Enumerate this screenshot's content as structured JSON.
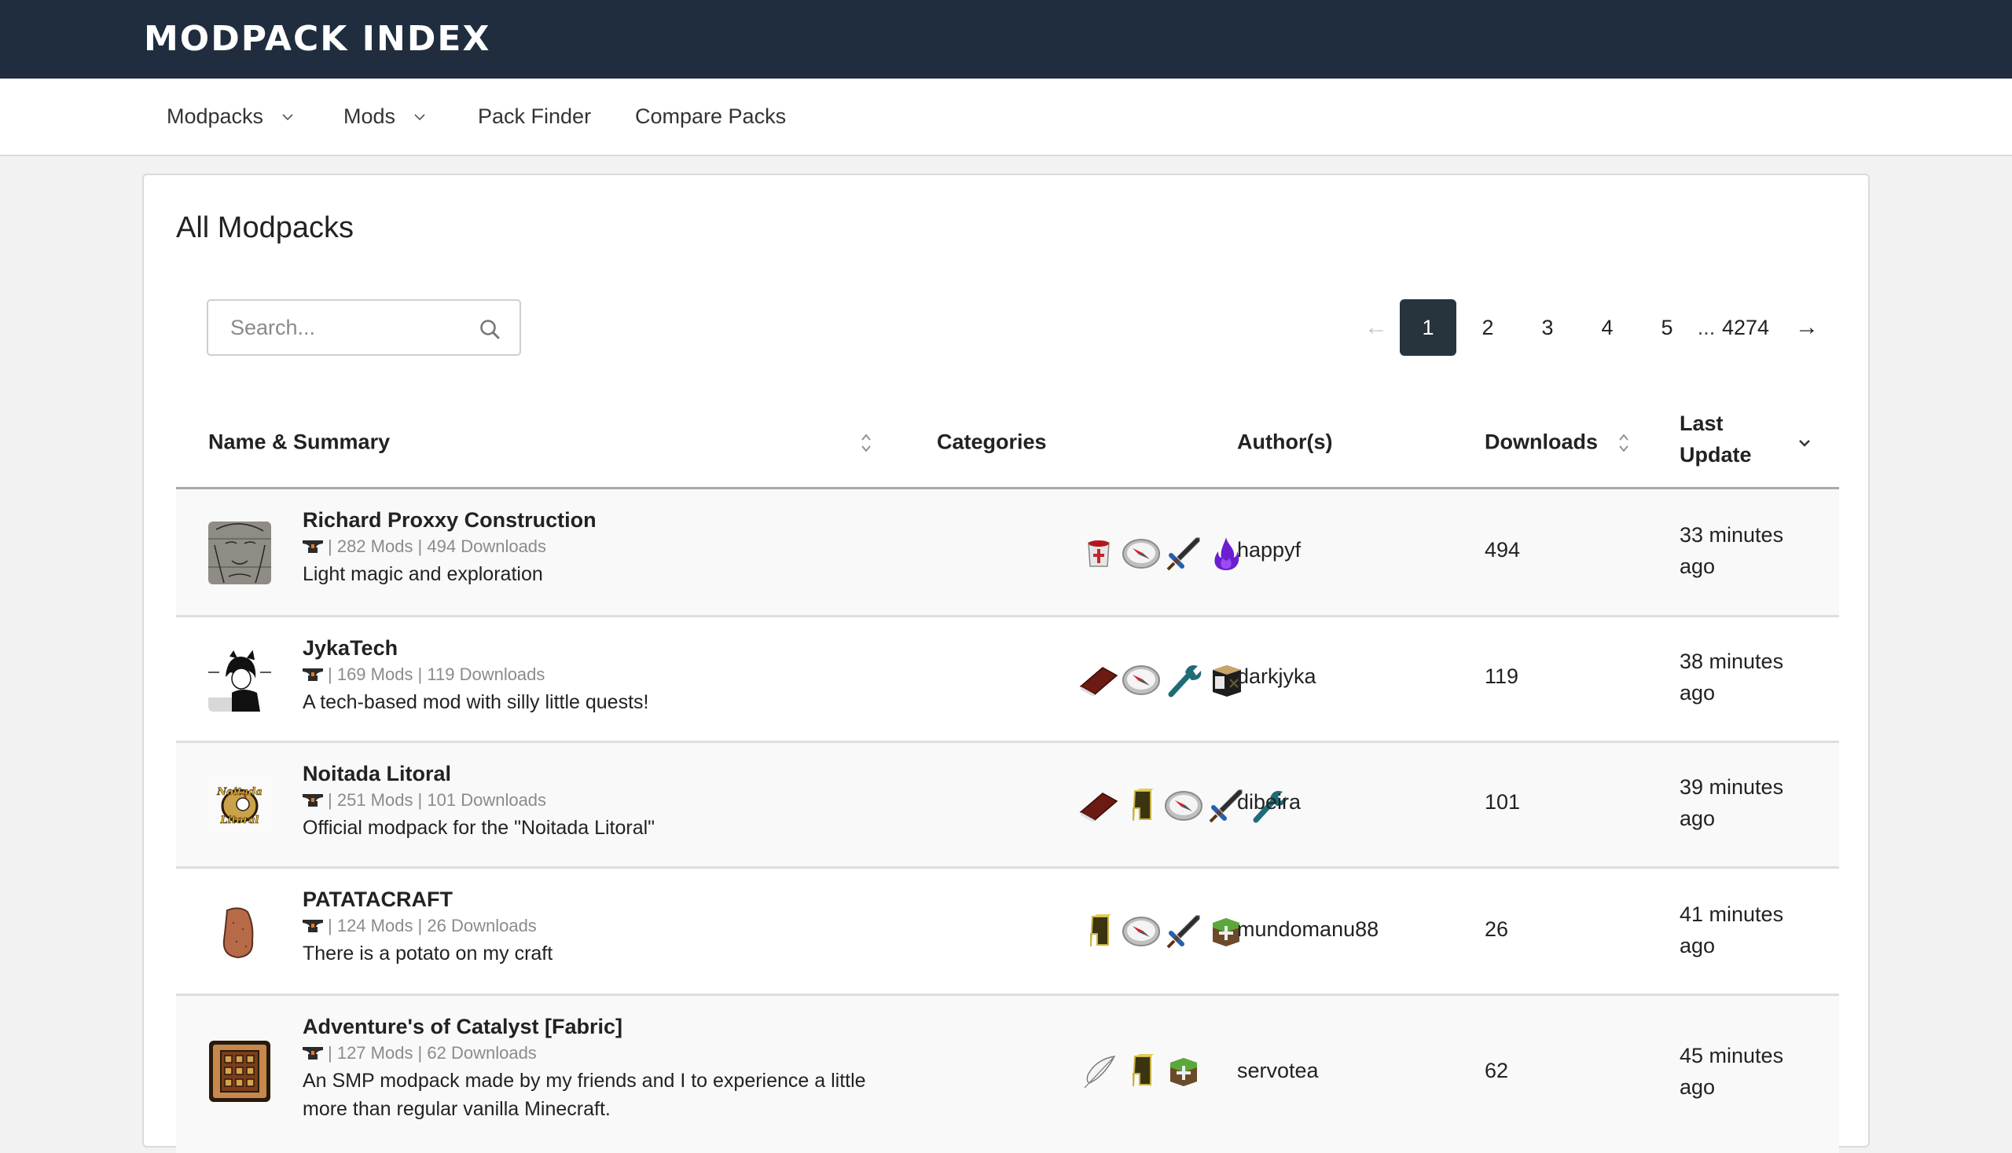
{
  "header": {
    "logo": "MODPACK INDEX",
    "brand_color": "#1f2d3f"
  },
  "nav": {
    "items": [
      {
        "label": "Modpacks",
        "has_dropdown": true
      },
      {
        "label": "Mods",
        "has_dropdown": true
      },
      {
        "label": "Pack Finder",
        "has_dropdown": false
      },
      {
        "label": "Compare Packs",
        "has_dropdown": false
      }
    ]
  },
  "page": {
    "title": "All Modpacks"
  },
  "search": {
    "placeholder": "Search...",
    "value": "",
    "icon": "search-icon"
  },
  "pagination": {
    "prev": "←",
    "next": "→",
    "pages": [
      "1",
      "2",
      "3",
      "4",
      "5"
    ],
    "current": "1",
    "ellipsis": "...",
    "last": "4274",
    "active_color": "#27343e"
  },
  "table": {
    "columns": [
      {
        "label": "Name & Summary",
        "sortable": true
      },
      {
        "label": "Categories",
        "sortable": false
      },
      {
        "label": "Author(s)",
        "sortable": false
      },
      {
        "label": "Downloads",
        "sortable": true
      },
      {
        "label": "Last Update",
        "sortable": true,
        "sorted": "desc"
      }
    ],
    "rows": [
      {
        "name": "Richard Proxxy Construction",
        "meta": "| 282 Mods | 494 Downloads",
        "loader_icon": "anvil-icon",
        "summary": "Light magic and exploration",
        "categories": [
          "paint-bucket",
          "compass",
          "sword",
          "purple-flame"
        ],
        "author": "happyf",
        "downloads": "494",
        "updated": "33 minutes ago",
        "avatar": "sketch-portrait"
      },
      {
        "name": "JykaTech",
        "meta": "| 169 Mods | 119 Downloads",
        "loader_icon": "anvil-icon",
        "summary": "A tech-based mod with silly little quests!",
        "categories": [
          "book",
          "compass",
          "wrench",
          "crafting-crate"
        ],
        "author": "darkjyka",
        "downloads": "119",
        "updated": "38 minutes ago",
        "avatar": "catgirl-drawing"
      },
      {
        "name": "Noitada Litoral",
        "meta": "| 251 Mods | 101 Downloads",
        "loader_icon": "anvil-icon",
        "summary": "Official modpack for the \"Noitada Litoral\"",
        "categories": [
          "book",
          "yellow-block",
          "compass",
          "sword",
          "wrench"
        ],
        "author": "dibeira",
        "downloads": "101",
        "updated": "39 minutes ago",
        "avatar": "noitada-logo"
      },
      {
        "name": "PATATACRAFT",
        "meta": "| 124 Mods | 26 Downloads",
        "loader_icon": "anvil-icon",
        "summary": "There is a potato on my craft",
        "categories": [
          "yellow-block",
          "compass",
          "sword",
          "grass-plus"
        ],
        "author": "mundomanu88",
        "downloads": "26",
        "updated": "41 minutes ago",
        "avatar": "potato"
      },
      {
        "name": "Adventure's of Catalyst [Fabric]",
        "meta": "| 127 Mods | 62 Downloads",
        "loader_icon": "anvil-icon",
        "summary": "An SMP modpack made by my friends and I to experience a little more than regular vanilla Minecraft.",
        "categories": [
          "feather",
          "yellow-block",
          "grass-plus"
        ],
        "author": "servotea",
        "downloads": "62",
        "updated": "45 minutes ago",
        "avatar": "crafting-table"
      }
    ]
  }
}
